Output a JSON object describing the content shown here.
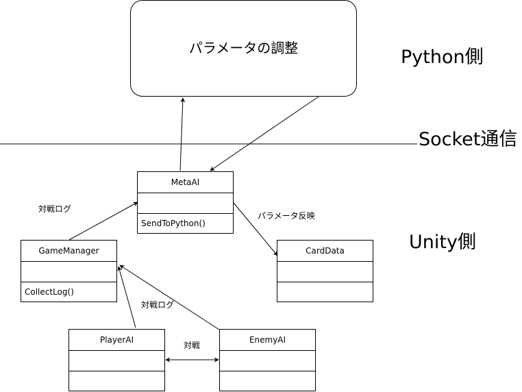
{
  "labels": {
    "python_side": "Python側",
    "socket": "Socket通信",
    "unity_side": "Unity側",
    "param_adjust": "パラメータの調整",
    "battle_log_1": "対戦ログ",
    "battle_log_2": "対戦ログ",
    "param_reflect": "パラメータ反映",
    "battle": "対戦"
  },
  "classes": {
    "metaai": {
      "name": "MetaAI",
      "method": "SendToPython()"
    },
    "gamemanager": {
      "name": "GameManager",
      "method": "CollectLog()"
    },
    "carddata": {
      "name": "CardData"
    },
    "playerai": {
      "name": "PlayerAI"
    },
    "enemyai": {
      "name": "EnemyAI"
    }
  },
  "colors": {
    "stroke": "#000000",
    "background": "#ffffff"
  }
}
